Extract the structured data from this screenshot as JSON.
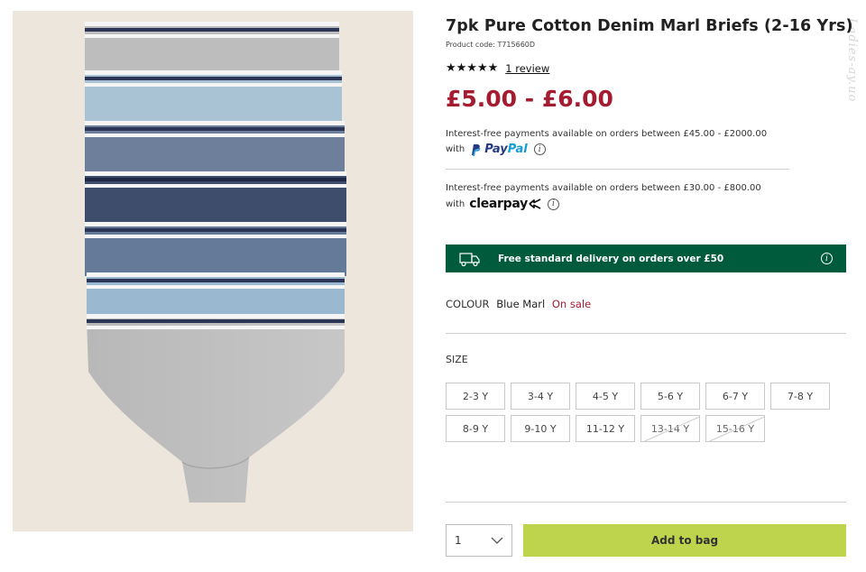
{
  "product": {
    "title": "7pk Pure Cotton Denim Marl Briefs (2-16 Yrs)",
    "code": "Product code: T715660D",
    "rating_stars": "★★★★★",
    "review_link": "1 review",
    "price": "£5.00 - £6.00"
  },
  "payments": {
    "paypal_line1": "Interest-free payments available on orders between £45.00 - £2000.00",
    "paypal_line2": "with",
    "paypal_brand_a": "Pay",
    "paypal_brand_b": "Pal",
    "clearpay_line1": "Interest-free payments available on orders between £30.00 - £800.00",
    "clearpay_line2": "with",
    "clearpay_brand": "clearpay"
  },
  "delivery": {
    "text": "Free standard delivery on orders over £50",
    "icon": "truck-icon",
    "color": "#005a3c"
  },
  "colour": {
    "label": "COLOUR",
    "value": "Blue Marl",
    "sale": "On sale"
  },
  "size": {
    "label": "SIZE",
    "options": [
      "2-3 Y",
      "3-4 Y",
      "4-5 Y",
      "5-6 Y",
      "6-7 Y",
      "7-8 Y",
      "8-9 Y",
      "9-10 Y",
      "11-12 Y",
      "13-14 Y",
      "15-16 Y"
    ],
    "out_of_stock": [
      "13-14 Y",
      "15-16 Y"
    ]
  },
  "quantity": {
    "value": "1"
  },
  "actions": {
    "add_to_bag": "Add to bag",
    "accent": "#bdd44c"
  },
  "watermark": "Ladies-ay.uo",
  "info_glyph": "i"
}
